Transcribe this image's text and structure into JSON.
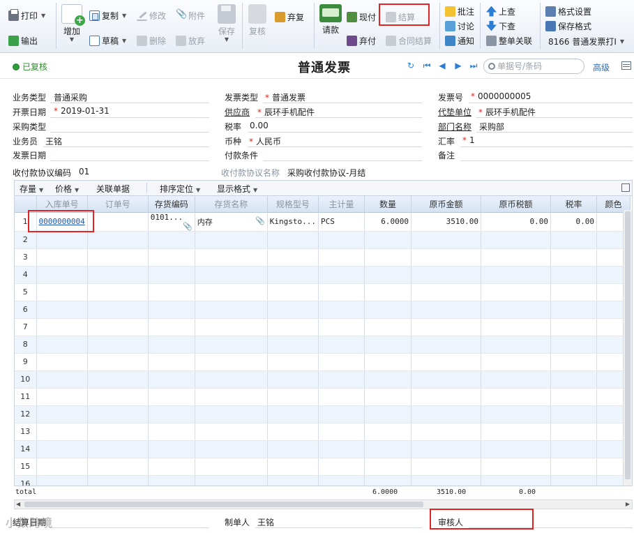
{
  "toolbar": {
    "print": "打印",
    "export": "输出",
    "add": "增加",
    "copy": "复制",
    "draft": "草稿",
    "modify": "修改",
    "delete": "删除",
    "attachment": "附件",
    "abandon": "放弃",
    "save": "保存",
    "review": "复核",
    "discard_review": "弃复",
    "request_payment": "请款",
    "cash_pay": "现付",
    "discard_pay": "弃付",
    "settle": "结算",
    "contract_settle": "合同结算",
    "annotate": "批注",
    "discuss": "讨论",
    "notify": "通知",
    "prev_record": "上查",
    "next_record": "下查",
    "full_link": "整单关联",
    "format_settings": "格式设置",
    "save_format": "保存格式",
    "print_template": "8166 普通发票打I"
  },
  "titlebar": {
    "status": "已复核",
    "title": "普通发票",
    "search_placeholder": "单据号/条码",
    "advanced": "高级"
  },
  "header": {
    "business_type_label": "业务类型",
    "business_type": "普通采购",
    "invoice_type_label": "发票类型",
    "invoice_type": "普通发票",
    "invoice_no_label": "发票号",
    "invoice_no": "0000000005",
    "issue_date_label": "开票日期",
    "issue_date": "2019-01-31",
    "supplier_label": "供应商",
    "supplier": "辰环手机配件",
    "payee_label": "代垫单位",
    "payee": "辰环手机配件",
    "purchase_type_label": "采购类型",
    "purchase_type": "",
    "tax_rate_label": "税率",
    "tax_rate": "0.00",
    "dept_label": "部门名称",
    "dept": "采购部",
    "salesman_label": "业务员",
    "salesman": "王铭",
    "currency_label": "币种",
    "currency": "人民币",
    "exchange_rate_label": "汇率",
    "exchange_rate": "1",
    "invoice_date_label": "发票日期",
    "invoice_date": "",
    "payment_terms_label": "付款条件",
    "payment_terms": "",
    "remark_label": "备注",
    "remark": "",
    "agreement_code_label": "收付款协议编码",
    "agreement_code": "01",
    "agreement_name_label": "收付款协议名称",
    "agreement_name": "采购收付款协议-月结"
  },
  "gridbar": {
    "stock": "存量",
    "price": "价格",
    "related": "关联单据",
    "sort": "排序定位",
    "display": "显示格式"
  },
  "grid": {
    "columns": [
      "入库单号",
      "订单号",
      "存货编码",
      "存货名称",
      "规格型号",
      "主计量",
      "数量",
      "原币金额",
      "原币税额",
      "税率",
      "颜色"
    ],
    "row1": {
      "no": "1",
      "receipt_no": "0000000004",
      "order_no": "",
      "item_code": "0101...",
      "item_name": "内存",
      "spec": "Kingsto...",
      "unit": "PCS",
      "qty": "6.0000",
      "amount": "3510.00",
      "tax": "0.00",
      "rate": "0.00",
      "color": ""
    },
    "row_numbers": [
      "2",
      "3",
      "4",
      "5",
      "6",
      "7",
      "8",
      "9",
      "10",
      "11",
      "12",
      "13",
      "14",
      "15",
      "16"
    ],
    "total_label": "total",
    "total_qty": "6.0000",
    "total_amount": "3510.00",
    "total_tax": "0.00"
  },
  "footer": {
    "settle_date_label": "结算日期",
    "settle_date": "",
    "maker_label": "制单人",
    "maker": "王铭",
    "reviewer_label": "审核人",
    "reviewer": ""
  },
  "watermark": "小数跨境"
}
